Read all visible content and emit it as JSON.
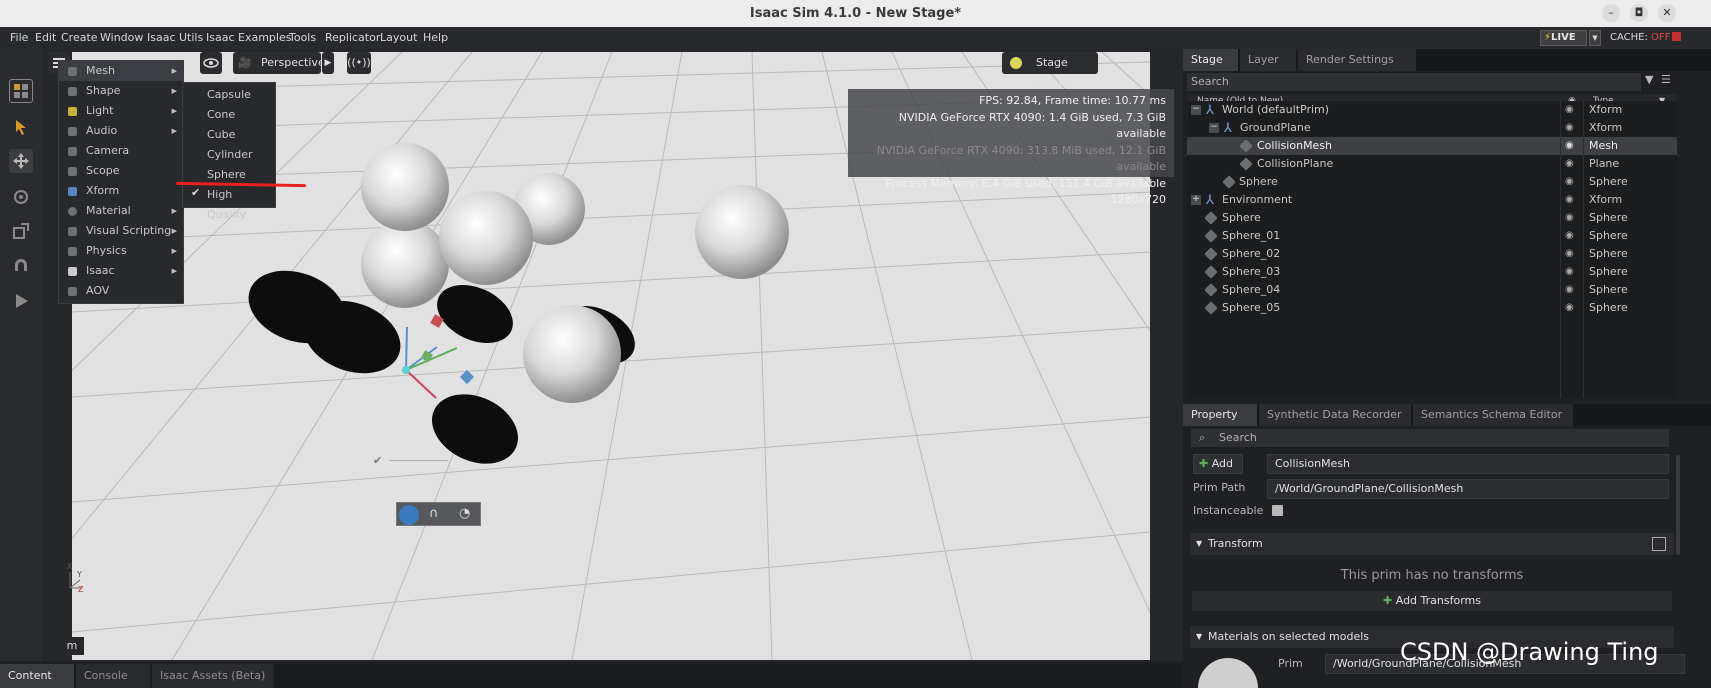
{
  "window": {
    "title": "Isaac Sim 4.1.0 - New Stage*",
    "minimize": "▢",
    "maximize": "◘",
    "close": "✕"
  },
  "menubar": {
    "items": [
      "File",
      "Edit",
      "Create",
      "Window",
      "Isaac Utils",
      "Isaac Examples",
      "Tools",
      "Replicator",
      "Layout",
      "Help"
    ],
    "live_label": "LIVE",
    "cache_label": "CACHE:",
    "cache_state": "OFF"
  },
  "viewport": {
    "camera_label": "Perspective",
    "lights_label": "Stage Lights",
    "stats": {
      "fps": "FPS: 92.84, Frame time: 10.77 ms",
      "gpu1": "NVIDIA GeForce RTX 4090: 1.4 GiB used, 7.3 GiB available",
      "gpu2": "NVIDIA GeForce RTX 4090: 313.8 MiB used, 12.1 GiB available",
      "process": "Process Memory: 6.4 GiB used, 151.4 GiB available",
      "resolution": "1280x720"
    },
    "axis_labels": {
      "y": "Y",
      "x": "X",
      "z": "Z"
    },
    "unit_label": "m"
  },
  "create_menu": {
    "items": [
      "Mesh",
      "Shape",
      "Light",
      "Audio",
      "Camera",
      "Scope",
      "Xform",
      "Material",
      "Visual Scripting",
      "Physics",
      "Isaac",
      "AOV"
    ],
    "shape_submenu": [
      "Capsule",
      "Cone",
      "Cube",
      "Cylinder",
      "Sphere",
      "High Quality"
    ]
  },
  "stage": {
    "tabs": [
      "Stage",
      "Layer",
      "Render Settings"
    ],
    "search_placeholder": "Search",
    "col_name": "Name (Old to New)",
    "col_type": "Type",
    "rows": [
      {
        "name": "World (defaultPrim)",
        "type": "Xform"
      },
      {
        "name": "GroundPlane",
        "type": "Xform"
      },
      {
        "name": "CollisionMesh",
        "type": "Mesh"
      },
      {
        "name": "CollisionPlane",
        "type": "Plane"
      },
      {
        "name": "Sphere",
        "type": "Sphere"
      },
      {
        "name": "Environment",
        "type": "Xform"
      },
      {
        "name": "Sphere",
        "type": "Sphere"
      },
      {
        "name": "Sphere_01",
        "type": "Sphere"
      },
      {
        "name": "Sphere_02",
        "type": "Sphere"
      },
      {
        "name": "Sphere_03",
        "type": "Sphere"
      },
      {
        "name": "Sphere_04",
        "type": "Sphere"
      },
      {
        "name": "Sphere_05",
        "type": "Sphere"
      }
    ]
  },
  "property": {
    "tabs": [
      "Property",
      "Synthetic Data Recorder",
      "Semantics Schema Editor"
    ],
    "search_placeholder": "Search",
    "add_label": "Add",
    "prim_name": "CollisionMesh",
    "prim_path_label": "Prim Path",
    "prim_path": "/World/GroundPlane/CollisionMesh",
    "instanceable_label": "Instanceable",
    "transform_header": "Transform",
    "no_transforms": "This prim has no transforms",
    "add_transforms": "Add Transforms",
    "materials_header": "Materials on selected models",
    "material_prim_label": "Prim",
    "material_prim_value": "/World/GroundPlane/CollisionMesh"
  },
  "bottom_tabs": [
    "Content",
    "Console",
    "Isaac Assets (Beta)"
  ],
  "watermark": "CSDN @Drawing Ting"
}
